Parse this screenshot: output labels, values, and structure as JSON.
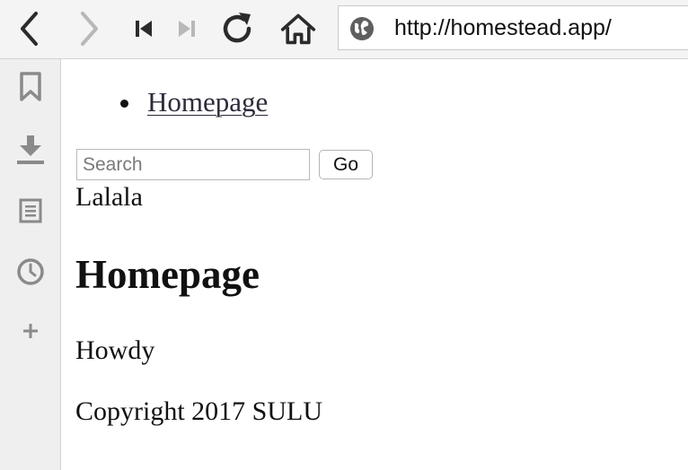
{
  "toolbar": {
    "url": "http://homestead.app/",
    "icons": {
      "back": "chevron-left-icon",
      "forward": "chevron-right-icon",
      "first": "skip-back-icon",
      "last": "skip-forward-icon",
      "reload": "reload-icon",
      "home": "home-icon",
      "site": "globe-icon"
    }
  },
  "sidebar": {
    "icons": [
      "bookmark-icon",
      "download-icon",
      "reader-icon",
      "history-icon",
      "add-icon"
    ]
  },
  "page": {
    "nav": [
      {
        "label": "Homepage"
      }
    ],
    "search": {
      "placeholder": "Search",
      "value": "",
      "button_label": "Go"
    },
    "tagline": "Lalala",
    "heading": "Homepage",
    "body": "Howdy",
    "footer": "Copyright 2017 SULU"
  },
  "colors": {
    "toolbar_bg": "#f4f4f4",
    "sidebar_bg": "#efefef",
    "icon": "#2b2b2b",
    "icon_disabled": "#b8b8b8",
    "sidebar_icon": "#8a8a8a",
    "link": "#2c2c3a"
  }
}
